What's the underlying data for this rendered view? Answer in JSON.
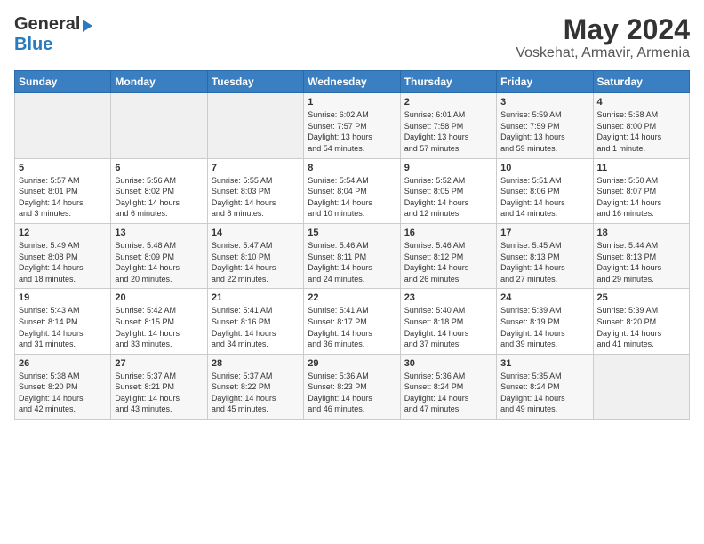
{
  "logo": {
    "general": "General",
    "blue": "Blue",
    "arrow": "▶"
  },
  "title": "May 2024",
  "subtitle": "Voskehat, Armavir, Armenia",
  "weekdays": [
    "Sunday",
    "Monday",
    "Tuesday",
    "Wednesday",
    "Thursday",
    "Friday",
    "Saturday"
  ],
  "weeks": [
    [
      {
        "day": "",
        "info": ""
      },
      {
        "day": "",
        "info": ""
      },
      {
        "day": "",
        "info": ""
      },
      {
        "day": "1",
        "info": "Sunrise: 6:02 AM\nSunset: 7:57 PM\nDaylight: 13 hours\nand 54 minutes."
      },
      {
        "day": "2",
        "info": "Sunrise: 6:01 AM\nSunset: 7:58 PM\nDaylight: 13 hours\nand 57 minutes."
      },
      {
        "day": "3",
        "info": "Sunrise: 5:59 AM\nSunset: 7:59 PM\nDaylight: 13 hours\nand 59 minutes."
      },
      {
        "day": "4",
        "info": "Sunrise: 5:58 AM\nSunset: 8:00 PM\nDaylight: 14 hours\nand 1 minute."
      }
    ],
    [
      {
        "day": "5",
        "info": "Sunrise: 5:57 AM\nSunset: 8:01 PM\nDaylight: 14 hours\nand 3 minutes."
      },
      {
        "day": "6",
        "info": "Sunrise: 5:56 AM\nSunset: 8:02 PM\nDaylight: 14 hours\nand 6 minutes."
      },
      {
        "day": "7",
        "info": "Sunrise: 5:55 AM\nSunset: 8:03 PM\nDaylight: 14 hours\nand 8 minutes."
      },
      {
        "day": "8",
        "info": "Sunrise: 5:54 AM\nSunset: 8:04 PM\nDaylight: 14 hours\nand 10 minutes."
      },
      {
        "day": "9",
        "info": "Sunrise: 5:52 AM\nSunset: 8:05 PM\nDaylight: 14 hours\nand 12 minutes."
      },
      {
        "day": "10",
        "info": "Sunrise: 5:51 AM\nSunset: 8:06 PM\nDaylight: 14 hours\nand 14 minutes."
      },
      {
        "day": "11",
        "info": "Sunrise: 5:50 AM\nSunset: 8:07 PM\nDaylight: 14 hours\nand 16 minutes."
      }
    ],
    [
      {
        "day": "12",
        "info": "Sunrise: 5:49 AM\nSunset: 8:08 PM\nDaylight: 14 hours\nand 18 minutes."
      },
      {
        "day": "13",
        "info": "Sunrise: 5:48 AM\nSunset: 8:09 PM\nDaylight: 14 hours\nand 20 minutes."
      },
      {
        "day": "14",
        "info": "Sunrise: 5:47 AM\nSunset: 8:10 PM\nDaylight: 14 hours\nand 22 minutes."
      },
      {
        "day": "15",
        "info": "Sunrise: 5:46 AM\nSunset: 8:11 PM\nDaylight: 14 hours\nand 24 minutes."
      },
      {
        "day": "16",
        "info": "Sunrise: 5:46 AM\nSunset: 8:12 PM\nDaylight: 14 hours\nand 26 minutes."
      },
      {
        "day": "17",
        "info": "Sunrise: 5:45 AM\nSunset: 8:13 PM\nDaylight: 14 hours\nand 27 minutes."
      },
      {
        "day": "18",
        "info": "Sunrise: 5:44 AM\nSunset: 8:13 PM\nDaylight: 14 hours\nand 29 minutes."
      }
    ],
    [
      {
        "day": "19",
        "info": "Sunrise: 5:43 AM\nSunset: 8:14 PM\nDaylight: 14 hours\nand 31 minutes."
      },
      {
        "day": "20",
        "info": "Sunrise: 5:42 AM\nSunset: 8:15 PM\nDaylight: 14 hours\nand 33 minutes."
      },
      {
        "day": "21",
        "info": "Sunrise: 5:41 AM\nSunset: 8:16 PM\nDaylight: 14 hours\nand 34 minutes."
      },
      {
        "day": "22",
        "info": "Sunrise: 5:41 AM\nSunset: 8:17 PM\nDaylight: 14 hours\nand 36 minutes."
      },
      {
        "day": "23",
        "info": "Sunrise: 5:40 AM\nSunset: 8:18 PM\nDaylight: 14 hours\nand 37 minutes."
      },
      {
        "day": "24",
        "info": "Sunrise: 5:39 AM\nSunset: 8:19 PM\nDaylight: 14 hours\nand 39 minutes."
      },
      {
        "day": "25",
        "info": "Sunrise: 5:39 AM\nSunset: 8:20 PM\nDaylight: 14 hours\nand 41 minutes."
      }
    ],
    [
      {
        "day": "26",
        "info": "Sunrise: 5:38 AM\nSunset: 8:20 PM\nDaylight: 14 hours\nand 42 minutes."
      },
      {
        "day": "27",
        "info": "Sunrise: 5:37 AM\nSunset: 8:21 PM\nDaylight: 14 hours\nand 43 minutes."
      },
      {
        "day": "28",
        "info": "Sunrise: 5:37 AM\nSunset: 8:22 PM\nDaylight: 14 hours\nand 45 minutes."
      },
      {
        "day": "29",
        "info": "Sunrise: 5:36 AM\nSunset: 8:23 PM\nDaylight: 14 hours\nand 46 minutes."
      },
      {
        "day": "30",
        "info": "Sunrise: 5:36 AM\nSunset: 8:24 PM\nDaylight: 14 hours\nand 47 minutes."
      },
      {
        "day": "31",
        "info": "Sunrise: 5:35 AM\nSunset: 8:24 PM\nDaylight: 14 hours\nand 49 minutes."
      },
      {
        "day": "",
        "info": ""
      }
    ]
  ]
}
